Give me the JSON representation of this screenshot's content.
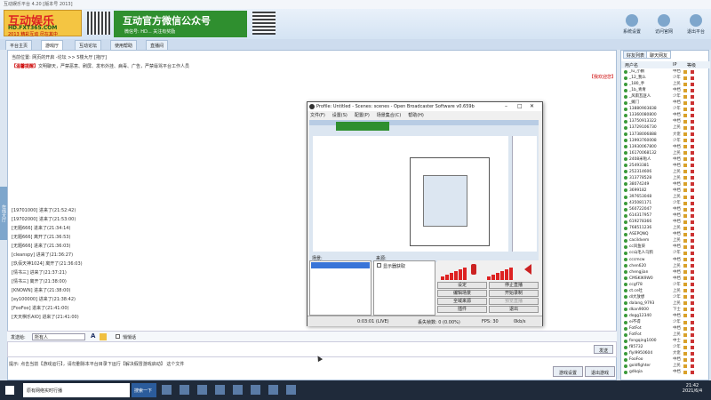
{
  "window": {
    "title": "互动娱乐平台 4.20 [版本号 2013]"
  },
  "banner": {
    "logo_main": "互动娱乐",
    "logo_url": "HD.FXT365.COM",
    "logo_sub": "2013 精彩互动 尽在其中",
    "wechat_title": "互动官方微信公众号",
    "wechat_sub": "微信号: HD...  关注有奖励"
  },
  "topbuttons": [
    {
      "label": "系统设置",
      "icon": "gear-icon"
    },
    {
      "label": "访问官网",
      "icon": "home-icon"
    },
    {
      "label": "退出平台",
      "icon": "power-icon"
    }
  ],
  "nav": {
    "tabs": [
      "平台主页",
      "游戏厅",
      "互动论坛",
      "使用帮助",
      "直播间"
    ]
  },
  "main": {
    "location": "当前位置: 网页的开启 -论坛 >> 5楼大厅 [拖厅]",
    "notice_label": "【温馨提醒】",
    "notice_text": "文明聊天，严禁恶意、刷屏、发布外挂、病毒、广告，严禁辱骂平台工作人员",
    "top_right": "【我欢迎您】"
  },
  "sidetab": "在线大厅",
  "chatlog": [
    "[19701000] 进来了(21:52:42)",
    "[19702000] 进来了(21:53:00)",
    "[无题666] 进来了(21:34:14)",
    "[无题666] 离开了(21:36:53)",
    "[无题666] 进来了(21:36:03)",
    "[cleanspy] 进来了(21:36:27)",
    "[玖佰天神1024] 离开了(21:36:03)",
    "[情书三] 进来了(21:37:21)",
    "[情书三] 离开了(21:38:00)",
    "[KNOWN] 进来了(21:38:00)",
    "[ey100000] 进来了(21:38:42)",
    "[FooFoo] 进来了(21:41:00)",
    "[天天棋乐AIO] 进来了(21:41:00)"
  ],
  "sendbar": {
    "label": "发送给:",
    "target": "所有人",
    "checkbox": "悄悄话"
  },
  "send_button": "发送",
  "tips": "提示: 点击当前【游戏运行】，请勿删除本平台目录下运行【解决假冒游戏启动】 这个文件",
  "bottom_buttons": [
    "游戏设置",
    "退出游戏"
  ],
  "rightpanel": {
    "tabs": [
      "好友列表",
      "聊天网友"
    ],
    "headers": [
      "用户名",
      "IP",
      "等级"
    ],
    "users": [
      [
        "_lu_小鹏",
        "中档"
      ],
      [
        "_12_我么",
        "少年"
      ],
      [
        "_180_手",
        "上民"
      ],
      [
        "_1b_青青",
        "中档"
      ],
      [
        "_风雨瓦匪人",
        "少年"
      ],
      [
        "_摊门",
        "中档"
      ],
      [
        "13880903838",
        "少年"
      ],
      [
        "13360080800",
        "中档"
      ],
      [
        "13750913322",
        "中档"
      ],
      [
        "13729106730",
        "上民"
      ],
      [
        "13738006888",
        "大佬"
      ],
      [
        "13993760008",
        "少年"
      ],
      [
        "13930067800",
        "中档"
      ],
      [
        "16170068132",
        "上民"
      ],
      [
        "2408米啦人",
        "中档"
      ],
      [
        "25493381",
        "中档"
      ],
      [
        "252314606",
        "上民"
      ],
      [
        "313778528",
        "上民"
      ],
      [
        "38074249",
        "中档"
      ],
      [
        "3699182",
        "中档"
      ],
      [
        "397653048",
        "上民"
      ],
      [
        "435081171",
        "少年"
      ],
      [
        "560722047",
        "中档"
      ],
      [
        "614317957",
        "中档"
      ],
      [
        "619278366",
        "中档"
      ],
      [
        "768511236",
        "上民"
      ],
      [
        "ASEPQNQ",
        "中档"
      ],
      [
        "cacildvem",
        "上民"
      ],
      [
        "cc风鱼柒",
        "中档"
      ],
      [
        "cc山毛人乌鸦",
        "少年"
      ],
      [
        "cccmcw",
        "中档"
      ],
      [
        "chen620",
        "上民"
      ],
      [
        "chengjian",
        "中档"
      ],
      [
        "CMSKIK9W0",
        "中档"
      ],
      [
        "ccgf78",
        "少年"
      ],
      [
        "ct.ce吐",
        "上民"
      ],
      [
        "dl大放想",
        "少年"
      ],
      [
        "dalang_9793",
        "上民"
      ],
      [
        "dkan9000",
        "下士"
      ],
      [
        "dogg12340",
        "中档"
      ],
      [
        "ei不得",
        "少年"
      ],
      [
        "FotFot",
        "中档"
      ],
      [
        "FotFot",
        "上民"
      ],
      [
        "fongqing1000",
        "中士"
      ],
      [
        "f85732",
        "少年"
      ],
      [
        "flyl9950604",
        "大佬"
      ],
      [
        "FooFoo",
        "中档"
      ],
      [
        "goldfighter",
        "上民"
      ],
      [
        "gdkqia",
        "中档"
      ]
    ]
  },
  "obs": {
    "title": "Profile: Untitled - Scenes: scenes - Open Broadcaster Software v0.659b",
    "menu": [
      "文件(F)",
      "设置(S)",
      "配置(P)",
      "场景集合(C)",
      "帮助(H)"
    ],
    "scenes_label": "场景:",
    "sources_label": "来源:",
    "source_item": "显示器获取",
    "buttons": [
      "设定",
      "停止直播",
      "编辑场景",
      "开始录制",
      "全域来源",
      "预览直播",
      "插件",
      "退出"
    ],
    "status": [
      "0:03:01 (LIVE)",
      "丢失帧数: 0 (0.00%)",
      "FPS: 30",
      "0kb/s"
    ]
  },
  "taskbar": {
    "search": "原有网络实时行播",
    "app": "搜索一下",
    "time": "21:42",
    "date": "2021/6/4"
  }
}
